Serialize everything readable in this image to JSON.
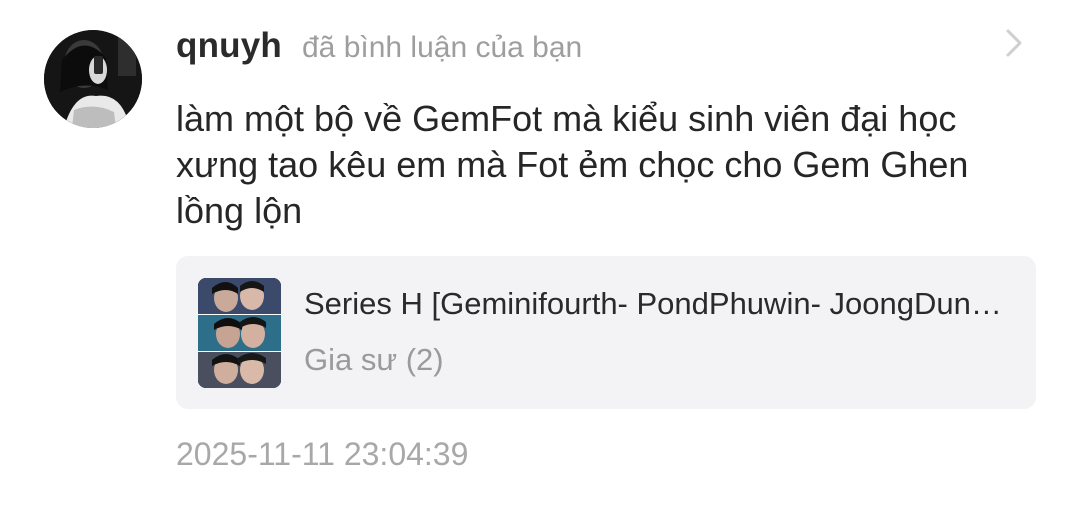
{
  "notification": {
    "user": {
      "name": "qnuyh",
      "avatar_icon": "profile-photo"
    },
    "action_text": "đã bình luận của bạn",
    "chevron_icon": "chevron-right-icon",
    "comment_text": "làm một bộ về GemFot mà kiểu sinh viên đại học xưng tao kêu em mà Fot ẻm chọc cho Gem Ghen lồng lộn",
    "story": {
      "cover_icon": "book-cover-image",
      "title": "Series H [Geminifourth- PondPhuwin- JoongDunk- ...",
      "chapter": "Gia sư (2)"
    },
    "timestamp": "2025-11-11 23:04:39"
  },
  "colors": {
    "username": "#2b2b2b",
    "secondary_text": "#9e9e9e",
    "card_background": "#f3f3f5",
    "timestamp": "#a8a8a8"
  }
}
